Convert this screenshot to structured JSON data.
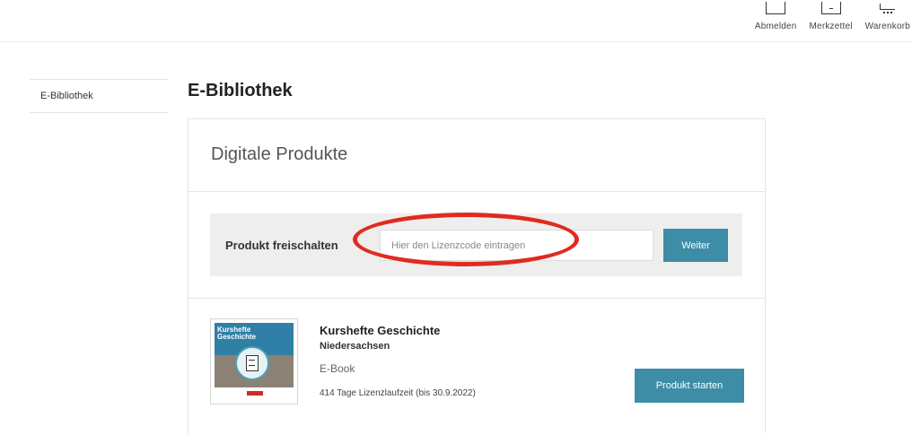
{
  "header": {
    "nav": [
      {
        "label": "Abmelden",
        "icon": "logout-icon"
      },
      {
        "label": "Merkzettel",
        "icon": "notepad-icon"
      },
      {
        "label": "Warenkorb",
        "icon": "cart-icon"
      }
    ]
  },
  "sidebar": {
    "items": [
      {
        "label": "E-Bibliothek"
      }
    ]
  },
  "main": {
    "title": "E-Bibliothek",
    "card_title": "Digitale Produkte",
    "unlock": {
      "label": "Produkt freischalten",
      "placeholder": "Hier den Lizenzcode eintragen",
      "button_label": "Weiter"
    },
    "product": {
      "title": "Kurshefte Geschichte",
      "subtitle": "Niedersachsen",
      "type": "E-Book",
      "license": "414 Tage Lizenzlaufzeit (bis 30.9.2022)",
      "button_label": "Produkt starten",
      "cover_text": "Kurshefte Geschichte"
    }
  },
  "colors": {
    "accent": "#3d8da6",
    "highlight": "#e02b20"
  }
}
